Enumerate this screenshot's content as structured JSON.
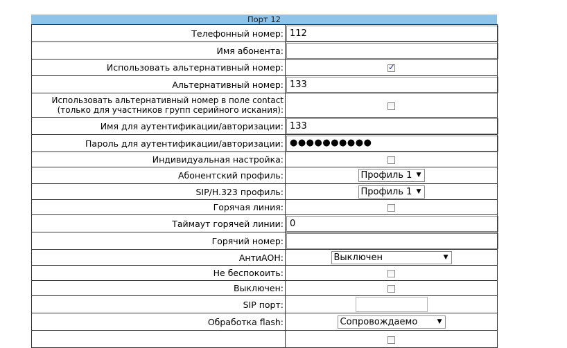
{
  "port_title": "Порт 12",
  "rows": {
    "phone": {
      "label": "Телефонный номер:",
      "value": "112"
    },
    "subscriber_name": {
      "label": "Имя абонента:",
      "value": ""
    },
    "use_alt": {
      "label": "Использовать альтернативный номер:",
      "checked": true
    },
    "alt_number": {
      "label": "Альтернативный номер:",
      "value": "133"
    },
    "use_alt_contact": {
      "label_line1": "Использовать альтернативный номер в поле contact",
      "label_line2": "(только для участников групп серийного искания):",
      "checked": false
    },
    "auth_name": {
      "label": "Имя для аутентификации/авторизации:",
      "value": "133"
    },
    "auth_password": {
      "label": "Пароль для аутентификации/авторизации:",
      "value": "●●●●●●●●●●"
    },
    "individual": {
      "label": "Индивидуальная настройка:",
      "checked": false
    },
    "subscriber_profile": {
      "label": "Абонентский профиль:",
      "value": "Профиль 1"
    },
    "sip_profile": {
      "label": "SIP/H.323 профиль:",
      "value": "Профиль 1"
    },
    "hotline": {
      "label": "Горячая линия:",
      "checked": false
    },
    "hotline_timeout": {
      "label": "Таймаут горячей линии:",
      "value": "0"
    },
    "hot_number": {
      "label": "Горячий номер:",
      "value": ""
    },
    "anti_aon": {
      "label": "АнтиАОН:",
      "value": "Выключен"
    },
    "dnd": {
      "label": "Не беспокоить:",
      "checked": false
    },
    "disabled": {
      "label": "Выключен:",
      "checked": false
    },
    "sip_port": {
      "label": "SIP порт:",
      "value": ""
    },
    "flash": {
      "label": "Обработка flash:",
      "value": "Сопровождаемо"
    }
  }
}
